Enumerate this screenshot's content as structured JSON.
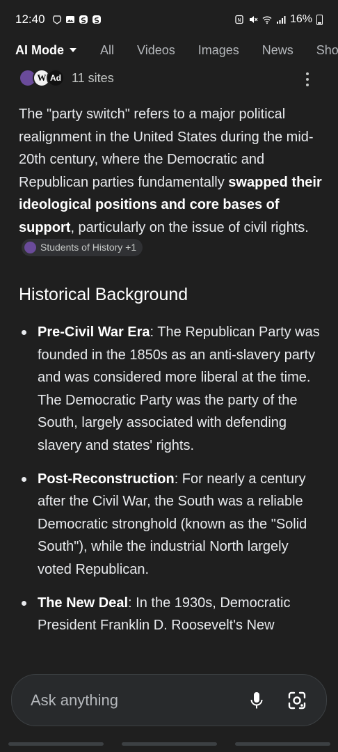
{
  "status": {
    "time": "12:40",
    "battery": "16%",
    "icons": [
      "brave-icon",
      "gallery-icon",
      "s-app-icon",
      "s-app-icon",
      "nfc-icon",
      "mute-icon",
      "wifi-icon",
      "signal-icon",
      "battery-icon"
    ]
  },
  "tabs": [
    {
      "label": "AI Mode",
      "active": true
    },
    {
      "label": "All"
    },
    {
      "label": "Videos"
    },
    {
      "label": "Images"
    },
    {
      "label": "News"
    },
    {
      "label": "Sho"
    }
  ],
  "sources": {
    "count_label": "11 sites",
    "favicons": [
      {
        "letter": "",
        "name": "students-of-history-favicon"
      },
      {
        "letter": "W",
        "name": "wikipedia-favicon"
      },
      {
        "letter": "Ad",
        "name": "site-favicon"
      }
    ]
  },
  "intro": {
    "part1": "The \"party switch\" refers to a major political realignment in the United States during the mid-20th century, where the Democratic and Republican parties fundamentally ",
    "bold": "swapped their ideological positions and core bases of support",
    "part2": ", particularly on the issue of civil rights.",
    "citation": "Students of History +1"
  },
  "heading": "Historical Background",
  "bullets": [
    {
      "title": "Pre-Civil War Era",
      "text": ": The Republican Party was founded in the 1850s as an anti-slavery party and was considered more liberal at the time. The Democratic Party was the party of the South, largely associated with defending slavery and states' rights."
    },
    {
      "title": "Post-Reconstruction",
      "text": ": For nearly a century after the Civil War, the South was a reliable Democratic stronghold (known as the \"Solid South\"), while the industrial North largely voted Republican."
    },
    {
      "title": "The New Deal",
      "text": ": In the 1930s, Democratic President Franklin D. Roosevelt's New"
    }
  ],
  "ask": {
    "placeholder": "Ask anything"
  },
  "colors": {
    "background": "#1f1f1f",
    "text": "#e8eaed",
    "muted": "#b5b8bc",
    "input_bg": "#282a2c"
  }
}
